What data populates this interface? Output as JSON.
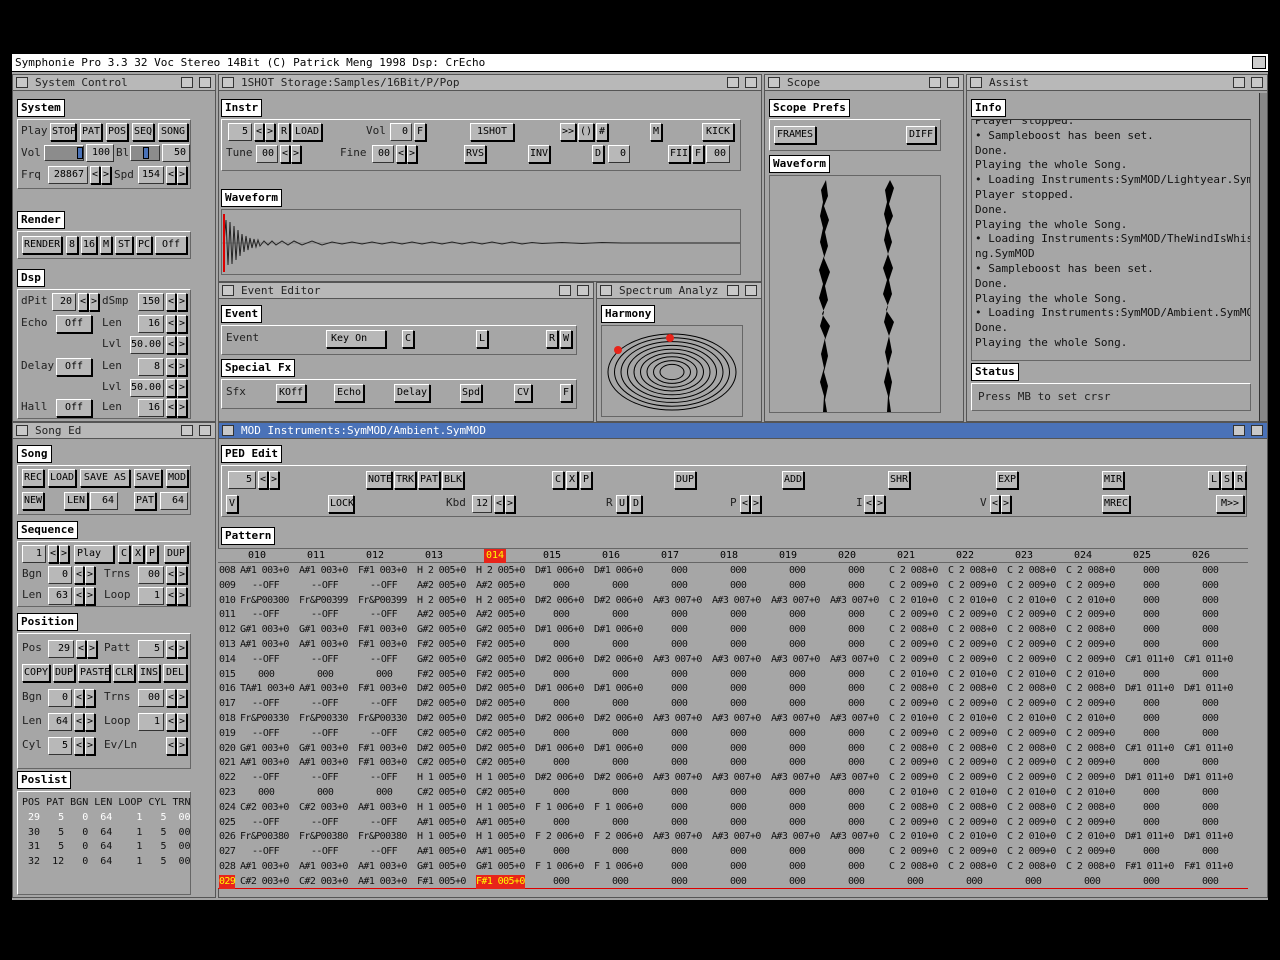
{
  "app_title": "Symphonie Pro 3.3  32 Voc Stereo 14Bit (C) Patrick Meng 1998  Dsp: CrEcho",
  "windows": {
    "system_control": "System Control",
    "instr_storage": "1SHOT Storage:Samples/16Bit/P/Pop",
    "scope": "Scope",
    "assist": "Assist",
    "event_editor": "Event Editor",
    "spectrum": "Spectrum Analyz",
    "song_ed": "Song Ed",
    "mod": "MOD   Instruments:SymMOD/Ambient.SymMOD"
  },
  "system": {
    "section": "System",
    "play_label": "Play",
    "stop": "STOP",
    "pat": "PAT",
    "pos": "POS",
    "seq": "SEQ",
    "song": "SONG",
    "vol_label": "Vol",
    "vol_value": "100",
    "bl_label": "Bl",
    "bl_value": "50",
    "frq_label": "Frq",
    "frq_value": "28867",
    "spd_label": "Spd",
    "spd_value": "154",
    "vol_level": 1.0,
    "bl_level": 0.5
  },
  "render": {
    "section": "Render",
    "render_btn": "RENDER",
    "b8": "8",
    "b16": "16",
    "m": "M",
    "st": "ST",
    "pc": "PC",
    "off": "Off"
  },
  "dsp": {
    "section": "Dsp",
    "dpit_label": "dPit",
    "dpit_value": "20",
    "dsmp_label": "dSmp",
    "dsmp_value": "150",
    "echo_label": "Echo",
    "echo_value": "Off",
    "len_label": "Len",
    "echo_len": "16",
    "lvl_label": "Lvl",
    "echo_lvl": "50.00",
    "delay_label": "Delay",
    "delay_value": "Off",
    "delay_len": "8",
    "delay_lvl": "50.00",
    "hall_label": "Hall",
    "hall_value": "Off",
    "hall_len": "16"
  },
  "instr": {
    "section": "Instr",
    "num": "5",
    "r": "R",
    "load": "LOAD",
    "vol_label": "Vol",
    "vol_value": "0",
    "f": "F",
    "oneshot": "1SHOT",
    "gt": ">>",
    "paren": "()",
    "hash": "#",
    "m": "M",
    "kick": "KICK",
    "tune_label": "Tune",
    "tune_value": "00",
    "fine_label": "Fine",
    "fine_value": "00",
    "rvs": "RVS",
    "inv": "INV",
    "d": "D",
    "d_value": "0",
    "fii": "FII",
    "f2": "F",
    "f_value": "00",
    "waveform_section": "Waveform"
  },
  "scope": {
    "prefs": "Scope Prefs",
    "frames": "FRAMES",
    "diff": "DIFF",
    "waveform": "Waveform"
  },
  "assist": {
    "info": "Info",
    "lines": [
      "Player stopped.",
      "• Sampleboost has been set.",
      "Done.",
      "Playing the whole Song.",
      "• Loading Instruments:SymMOD/Lightyear.SymMOD",
      "Player stopped.",
      "Done.",
      "Playing the whole Song.",
      "• Loading Instruments:SymMOD/TheWindIsWhisperi",
      "ng.SymMOD",
      "• Sampleboost has been set.",
      "Done.",
      "Playing the whole Song.",
      "• Loading Instruments:SymMOD/Ambient.SymMOD",
      "Done.",
      "Playing the whole Song."
    ],
    "status": "Status",
    "status_text": "Press MB to set crsr"
  },
  "event": {
    "section": "Event",
    "event_label": "Event",
    "key_on": "Key On",
    "c": "C",
    "l": "L",
    "r": "R",
    "w": "W",
    "special": "Special Fx",
    "sfx_label": "Sfx",
    "koff": "KOff",
    "echo": "Echo",
    "delay": "Delay",
    "spd": "Spd",
    "cv": "CV",
    "f": "F"
  },
  "spectrum": {
    "section": "Harmony"
  },
  "song": {
    "section": "Song",
    "rec": "REC",
    "load": "LOAD",
    "save_as": "SAVE AS",
    "save": "SAVE",
    "mod": "MOD",
    "new": "NEW",
    "len": "LEN",
    "len_value": "64",
    "pat": "PAT",
    "pat_value": "64",
    "sequence": "Sequence",
    "seq_num": "1",
    "play": "Play",
    "c": "C",
    "x": "X",
    "p": "P",
    "dup": "DUP",
    "bgn_label": "Bgn",
    "bgn_value": "0",
    "trns_label": "Trns",
    "trns_value": "00",
    "len_label": "Len",
    "seq_len": "63",
    "loop_label": "Loop",
    "loop_value": "1",
    "position": "Position",
    "pos_label": "Pos",
    "pos_value": "29",
    "patt_label": "Patt",
    "patt_value": "5",
    "copy": "COPY",
    "dup2": "DUP",
    "paste": "PASTE",
    "clr": "CLR",
    "ins": "INS",
    "del": "DEL",
    "pbgn": "0",
    "ptrns": "00",
    "plen": "64",
    "ploop": "1",
    "cyl_label": "Cyl",
    "cyl_value": "5",
    "evln_label": "Ev/Ln",
    "poslist": "Poslist",
    "poslist_header": "POS PAT BGN LEN LOOP CYL TRN",
    "poslist_rows": [
      {
        "text": " 29   5   0  64    1   5  00",
        "hl": true
      },
      {
        "text": " 30   5   0  64    1   5  00",
        "hl": false
      },
      {
        "text": " 31   5   0  64    1   5  00",
        "hl": false
      },
      {
        "text": " 32  12   0  64    1   5  00",
        "hl": false
      }
    ]
  },
  "ped": {
    "section": "PED Edit",
    "num": "5",
    "note": "NOTE",
    "trk": "TRK",
    "pat": "PAT",
    "blk": "BLK",
    "c": "C",
    "x": "X",
    "p": "P",
    "dup": "DUP",
    "add": "ADD",
    "shr": "SHR",
    "exp": "EXP",
    "mir": "MIR",
    "l": "L",
    "s": "S",
    "r": "R",
    "v": "V",
    "lock": "LOCK",
    "kbd_label": "Kbd",
    "kbd_value": "12",
    "r2": "R",
    "u": "U",
    "d": "D",
    "p_label": "P",
    "i_label": "I",
    "v_label": "V",
    "mrec": "MREC",
    "mgt": "M>>"
  },
  "pattern": {
    "section": "Pattern",
    "tracks": [
      "010",
      "011",
      "012",
      "013",
      "014",
      "015",
      "016",
      "017",
      "018",
      "019",
      "020",
      "021",
      "022",
      "023",
      "024",
      "025",
      "026"
    ],
    "current_track": "014",
    "rows": [
      {
        "n": "008",
        "c": [
          "A#1 003+0",
          "A#1 003+0",
          "F#1 003+0",
          "H 2 005+0",
          "H 2 005+0",
          "D#1 006+0",
          "D#1 006+0",
          "000",
          "000",
          "000",
          "000",
          "C 2 008+0",
          "C 2 008+0",
          "C 2 008+0",
          "C 2 008+0",
          "000",
          "000"
        ]
      },
      {
        "n": "009",
        "c": [
          "--OFF",
          "--OFF",
          "--OFF",
          "A#2 005+0",
          "A#2 005+0",
          "000",
          "000",
          "000",
          "000",
          "000",
          "000",
          "C 2 009+0",
          "C 2 009+0",
          "C 2 009+0",
          "C 2 009+0",
          "000",
          "000"
        ]
      },
      {
        "n": "010",
        "c": [
          "Fr&P00300",
          "Fr&P00399",
          "Fr&P00399",
          "H 2 005+0",
          "H 2 005+0",
          "D#2 006+0",
          "D#2 006+0",
          "A#3 007+0",
          "A#3 007+0",
          "A#3 007+0",
          "A#3 007+0",
          "C 2 010+0",
          "C 2 010+0",
          "C 2 010+0",
          "C 2 010+0",
          "000",
          "000"
        ]
      },
      {
        "n": "011",
        "c": [
          "--OFF",
          "--OFF",
          "--OFF",
          "A#2 005+0",
          "A#2 005+0",
          "000",
          "000",
          "000",
          "000",
          "000",
          "000",
          "C 2 009+0",
          "C 2 009+0",
          "C 2 009+0",
          "C 2 009+0",
          "000",
          "000"
        ]
      },
      {
        "n": "012",
        "c": [
          "G#1 003+0",
          "G#1 003+0",
          "F#1 003+0",
          "G#2 005+0",
          "G#2 005+0",
          "D#1 006+0",
          "D#1 006+0",
          "000",
          "000",
          "000",
          "000",
          "C 2 008+0",
          "C 2 008+0",
          "C 2 008+0",
          "C 2 008+0",
          "000",
          "000"
        ]
      },
      {
        "n": "013",
        "c": [
          "A#1 003+0",
          "A#1 003+0",
          "F#1 003+0",
          "F#2 005+0",
          "F#2 005+0",
          "000",
          "000",
          "000",
          "000",
          "000",
          "000",
          "C 2 009+0",
          "C 2 009+0",
          "C 2 009+0",
          "C 2 009+0",
          "000",
          "000"
        ]
      },
      {
        "n": "014",
        "c": [
          "--OFF",
          "--OFF",
          "--OFF",
          "G#2 005+0",
          "G#2 005+0",
          "D#2 006+0",
          "D#2 006+0",
          "A#3 007+0",
          "A#3 007+0",
          "A#3 007+0",
          "A#3 007+0",
          "C 2 009+0",
          "C 2 009+0",
          "C 2 009+0",
          "C 2 009+0",
          "C#1 011+0",
          "C#1 011+0"
        ]
      },
      {
        "n": "015",
        "c": [
          "000",
          "000",
          "000",
          "F#2 005+0",
          "F#2 005+0",
          "000",
          "000",
          "000",
          "000",
          "000",
          "000",
          "C 2 010+0",
          "C 2 010+0",
          "C 2 010+0",
          "C 2 010+0",
          "000",
          "000"
        ]
      },
      {
        "n": "016",
        "c": [
          "TA#1 003+0",
          "A#1 003+0",
          "F#1 003+0",
          "D#2 005+0",
          "D#2 005+0",
          "D#1 006+0",
          "D#1 006+0",
          "000",
          "000",
          "000",
          "000",
          "C 2 008+0",
          "C 2 008+0",
          "C 2 008+0",
          "C 2 008+0",
          "D#1 011+0",
          "D#1 011+0"
        ]
      },
      {
        "n": "017",
        "c": [
          "--OFF",
          "--OFF",
          "--OFF",
          "D#2 005+0",
          "D#2 005+0",
          "000",
          "000",
          "000",
          "000",
          "000",
          "000",
          "C 2 009+0",
          "C 2 009+0",
          "C 2 009+0",
          "C 2 009+0",
          "000",
          "000"
        ]
      },
      {
        "n": "018",
        "c": [
          "Fr&P00330",
          "Fr&P00330",
          "Fr&P00330",
          "D#2 005+0",
          "D#2 005+0",
          "D#2 006+0",
          "D#2 006+0",
          "A#3 007+0",
          "A#3 007+0",
          "A#3 007+0",
          "A#3 007+0",
          "C 2 010+0",
          "C 2 010+0",
          "C 2 010+0",
          "C 2 010+0",
          "000",
          "000"
        ]
      },
      {
        "n": "019",
        "c": [
          "--OFF",
          "--OFF",
          "--OFF",
          "C#2 005+0",
          "C#2 005+0",
          "000",
          "000",
          "000",
          "000",
          "000",
          "000",
          "C 2 009+0",
          "C 2 009+0",
          "C 2 009+0",
          "C 2 009+0",
          "000",
          "000"
        ]
      },
      {
        "n": "020",
        "c": [
          "G#1 003+0",
          "G#1 003+0",
          "F#1 003+0",
          "D#2 005+0",
          "D#2 005+0",
          "D#1 006+0",
          "D#1 006+0",
          "000",
          "000",
          "000",
          "000",
          "C 2 008+0",
          "C 2 008+0",
          "C 2 008+0",
          "C 2 008+0",
          "C#1 011+0",
          "C#1 011+0"
        ]
      },
      {
        "n": "021",
        "c": [
          "A#1 003+0",
          "A#1 003+0",
          "F#1 003+0",
          "C#2 005+0",
          "C#2 005+0",
          "000",
          "000",
          "000",
          "000",
          "000",
          "000",
          "C 2 009+0",
          "C 2 009+0",
          "C 2 009+0",
          "C 2 009+0",
          "000",
          "000"
        ]
      },
      {
        "n": "022",
        "c": [
          "--OFF",
          "--OFF",
          "--OFF",
          "H 1 005+0",
          "H 1 005+0",
          "D#2 006+0",
          "D#2 006+0",
          "A#3 007+0",
          "A#3 007+0",
          "A#3 007+0",
          "A#3 007+0",
          "C 2 009+0",
          "C 2 009+0",
          "C 2 009+0",
          "C 2 009+0",
          "D#1 011+0",
          "D#1 011+0"
        ]
      },
      {
        "n": "023",
        "c": [
          "000",
          "000",
          "000",
          "C#2 005+0",
          "C#2 005+0",
          "000",
          "000",
          "000",
          "000",
          "000",
          "000",
          "C 2 010+0",
          "C 2 010+0",
          "C 2 010+0",
          "C 2 010+0",
          "000",
          "000"
        ]
      },
      {
        "n": "024",
        "c": [
          "C#2 003+0",
          "C#2 003+0",
          "A#1 003+0",
          "H 1 005+0",
          "H 1 005+0",
          "F 1 006+0",
          "F 1 006+0",
          "000",
          "000",
          "000",
          "000",
          "C 2 008+0",
          "C 2 008+0",
          "C 2 008+0",
          "C 2 008+0",
          "000",
          "000"
        ]
      },
      {
        "n": "025",
        "c": [
          "--OFF",
          "--OFF",
          "--OFF",
          "A#1 005+0",
          "A#1 005+0",
          "000",
          "000",
          "000",
          "000",
          "000",
          "000",
          "C 2 009+0",
          "C 2 009+0",
          "C 2 009+0",
          "C 2 009+0",
          "000",
          "000"
        ]
      },
      {
        "n": "026",
        "c": [
          "Fr&P00380",
          "Fr&P00380",
          "Fr&P00380",
          "H 1 005+0",
          "H 1 005+0",
          "F 2 006+0",
          "F 2 006+0",
          "A#3 007+0",
          "A#3 007+0",
          "A#3 007+0",
          "A#3 007+0",
          "C 2 010+0",
          "C 2 010+0",
          "C 2 010+0",
          "C 2 010+0",
          "D#1 011+0",
          "D#1 011+0"
        ]
      },
      {
        "n": "027",
        "c": [
          "--OFF",
          "--OFF",
          "--OFF",
          "A#1 005+0",
          "A#1 005+0",
          "000",
          "000",
          "000",
          "000",
          "000",
          "000",
          "C 2 009+0",
          "C 2 009+0",
          "C 2 009+0",
          "C 2 009+0",
          "000",
          "000"
        ]
      },
      {
        "n": "028",
        "c": [
          "A#1 003+0",
          "A#1 003+0",
          "A#1 003+0",
          "G#1 005+0",
          "G#1 005+0",
          "F 1 006+0",
          "F 1 006+0",
          "000",
          "000",
          "000",
          "000",
          "C 2 008+0",
          "C 2 008+0",
          "C 2 008+0",
          "C 2 008+0",
          "F#1 011+0",
          "F#1 011+0"
        ]
      },
      {
        "n": "029",
        "c": [
          "C#2 003+0",
          "C#2 003+0",
          "A#1 003+0",
          "F#1 005+0",
          "F#1 005+0",
          "000",
          "000",
          "000",
          "000",
          "000",
          "000",
          "000",
          "000",
          "000",
          "000",
          "000",
          "000"
        ],
        "cur": true
      }
    ]
  }
}
